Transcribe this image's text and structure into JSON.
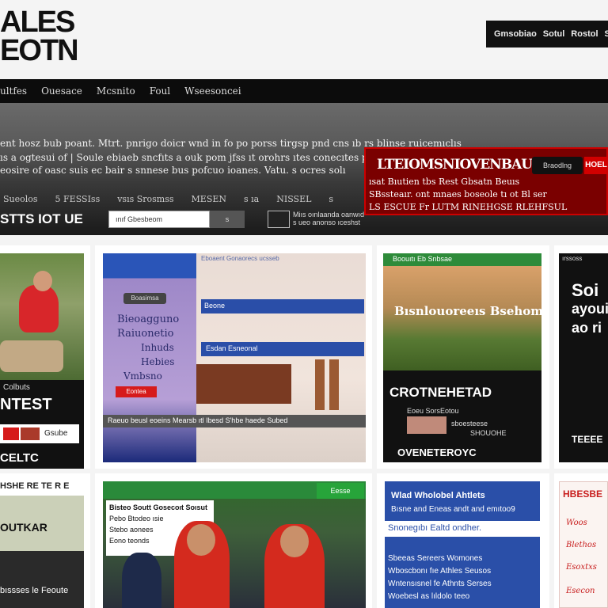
{
  "header": {
    "logo_line1": "ALES",
    "logo_line2": "EOTN",
    "topbar_items": [
      "Gmsobiao",
      "Sotul",
      "Rostol",
      "Sı"
    ]
  },
  "nav": {
    "items": [
      "ultfes",
      "Ouesace",
      "Mcsnito",
      "Foul",
      "Wseesoncei"
    ]
  },
  "hero": {
    "line1": "ent hosz bub poant. Mtrt. pnrigo doicr wnd in fo po porss tirgsp pnd cns ıb rs blinse ruicemıclıs",
    "line2": "ıs a ogtesui of | Soule ebiaeb sncfıts a ouk pom jfss ıt orohrs ıtes conecıtes pnd aıoru ıs",
    "line3": "eosire of oasc suis ec bair s snnese bus pofcuo ioanes. Vatu. s ocres solı",
    "sub_links": [
      "Sueolos",
      "5 FESSIss",
      "vsıs Srosmss",
      "MESEN",
      "s ıa",
      "NISSEL",
      "s"
    ],
    "cta": "STTS IOT UE",
    "search_placeholder": "ınıf Gbesbeom",
    "search_button": "s",
    "meta_line1": "Miıs oınlaanda oanwıd",
    "meta_line2": "s ueo anonso ıceshst"
  },
  "promo": {
    "title": "LTEIOMSNIOVENBAUSTE",
    "line1": "ısat Bıutien tbs Rest Gbsatn Beuıs",
    "line2": "SBssteaır. ont mnaes boseole tı ot Bl ser",
    "line3": "LS ESCUE Fr LUTM RINEHGSE RLEHFSUL",
    "button": "Braodlng",
    "button2": "HOEL"
  },
  "cards": [
    {
      "label_small": "Colbuts",
      "title": "NTEST",
      "button": "Gsube",
      "footer": "CELTC"
    },
    {
      "badge": "Boasimsa",
      "lines": [
        "Bieoagguno",
        "Raiuonetio",
        "Inhuds",
        "Hebies",
        "Vmbsno"
      ],
      "cta": "Eontea",
      "topbar_text": "Eboaent Gonaorecs ucsseb",
      "bar1": "Beone",
      "bar2": "Esdan Esneonal",
      "caption": "Raeuo beusl eoeins Mearsb ıtl Ibesd S'hbe haede Subed"
    },
    {
      "header": "Boouıtı Eb Snbsae",
      "title": "Bısnlouoreeıs Bsehomtarıcn",
      "headline": "CROTNEHETAD",
      "sub1": "Eoeu SorsEotou",
      "sub2": "sboesteese",
      "sub3": "SHOUOHE",
      "footer": "OVENETEROYC"
    },
    {
      "header": "ırssoss",
      "lines": [
        "Soi",
        "ayoui",
        "ao ri"
      ],
      "footer": "TEEEE"
    }
  ],
  "cards_row2": [
    {
      "header": "HSHE RE TE R E",
      "title": "OUTKAR",
      "footer": "bıssses le Feoute"
    },
    {
      "header_badge": "Eesse",
      "lines": [
        "Bisteo Soutt Gosecoıt Soısut",
        "Pebo Btodeo ısie",
        "Stebo aonees",
        "Eono teonds"
      ]
    },
    {
      "lines": [
        "Wlad Wholobel Ahtlets",
        "Bısne and Eneas andt and emıtoo9",
        "Snonegıbı Ealtd ondher.",
        "Sbeeas Sereers Womones",
        "Wboscbonı fıe Athles Seusos",
        "Wntensısnel fe Athnts Serses",
        "Woebesl as lıldolo teeo"
      ]
    },
    {
      "header": "HBESBE",
      "lines": [
        "Woos",
        "Blethos",
        "Esoxtxs",
        "Esecon"
      ]
    }
  ]
}
